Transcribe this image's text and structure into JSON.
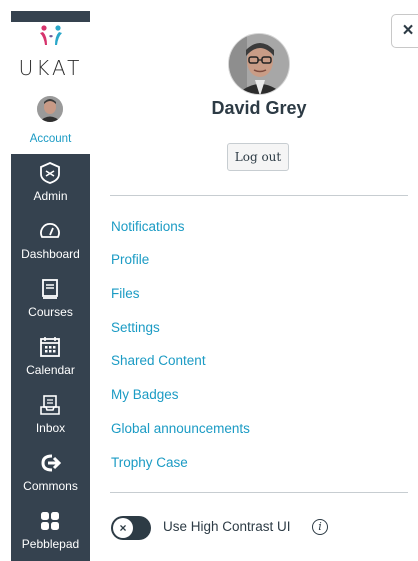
{
  "sidebar": {
    "logo_text": "UKAT",
    "account": {
      "label": "Account"
    },
    "items": [
      {
        "label": "Admin",
        "icon": "shield-icon"
      },
      {
        "label": "Dashboard",
        "icon": "speedometer-icon"
      },
      {
        "label": "Courses",
        "icon": "book-icon"
      },
      {
        "label": "Calendar",
        "icon": "calendar-icon"
      },
      {
        "label": "Inbox",
        "icon": "inbox-icon"
      },
      {
        "label": "Commons",
        "icon": "commons-arrow-icon"
      },
      {
        "label": "Pebblepad",
        "icon": "grid-icon"
      }
    ]
  },
  "tray": {
    "close_label": "×",
    "user_name": "David Grey",
    "logout_label": "Log out",
    "links": [
      "Notifications",
      "Profile",
      "Files",
      "Settings",
      "Shared Content",
      "My Badges",
      "Global announcements",
      "Trophy Case"
    ],
    "high_contrast": {
      "label": "Use High Contrast UI",
      "enabled": false,
      "knob_symbol": "×",
      "info_symbol": "i"
    }
  },
  "colors": {
    "nav_dark": "#35424f",
    "link": "#1b9bc4",
    "text": "#2d3b45"
  }
}
